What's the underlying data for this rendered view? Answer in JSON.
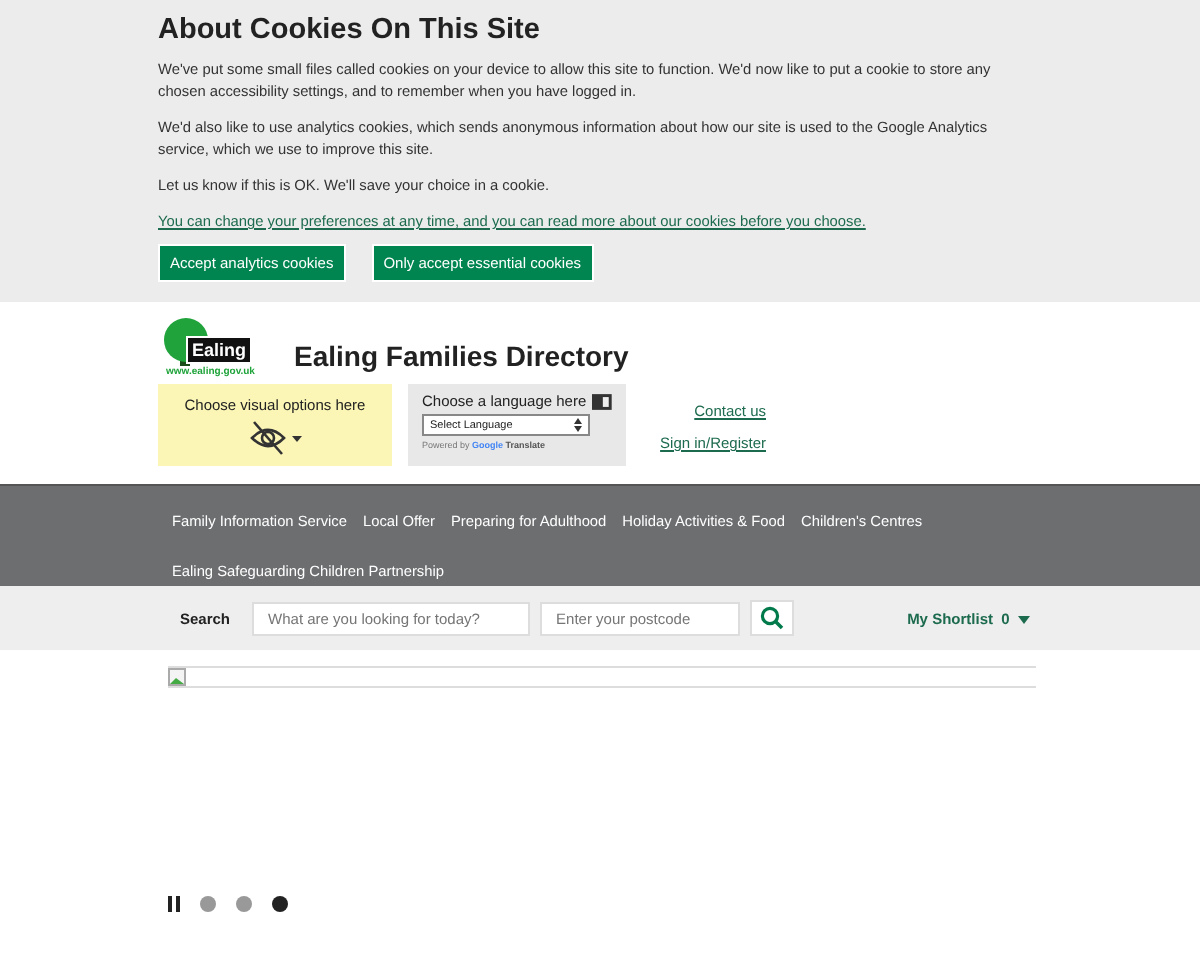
{
  "cookie_banner": {
    "title": "About Cookies On This Site",
    "paragraphs": [
      "We've put some small files called cookies on your device to allow this site to function. We'd now like to put a cookie to store any chosen accessibility settings, and to remember when you have logged in.",
      "We'd also like to use analytics cookies, which sends anonymous information about how our site is used to the Google Analytics service, which we use to improve this site.",
      "Let us know if this is OK. We'll save your choice in a cookie."
    ],
    "link": "You can change your preferences at any time, and you can read more about our cookies before you choose.",
    "buttons": [
      "Accept analytics cookies",
      "Only accept essential cookies"
    ]
  },
  "header": {
    "logo_text": "Ealing",
    "logo_url": "www.ealing.gov.uk",
    "site_title": "Ealing Families Directory",
    "visual_options": {
      "label": "Choose visual options here"
    },
    "language": {
      "label": "Choose a language here",
      "select": "Select Language",
      "powered_by": "Powered by",
      "google": "Google",
      "translate": "Translate"
    },
    "links": [
      "Contact us",
      "Sign in/Register"
    ]
  },
  "nav": {
    "items": [
      "Family Information Service",
      "Local Offer",
      "Preparing for Adulthood",
      "Holiday Activities & Food",
      "Children's Centres",
      "Ealing Safeguarding Children Partnership"
    ]
  },
  "search": {
    "label": "Search",
    "query_placeholder": "What are you looking for today?",
    "postcode_placeholder": "Enter your postcode",
    "shortlist": "My Shortlist",
    "shortlist_count": "0"
  },
  "carousel": {
    "slides": [
      {
        "selected": false
      },
      {
        "selected": false
      },
      {
        "selected": true
      }
    ]
  }
}
